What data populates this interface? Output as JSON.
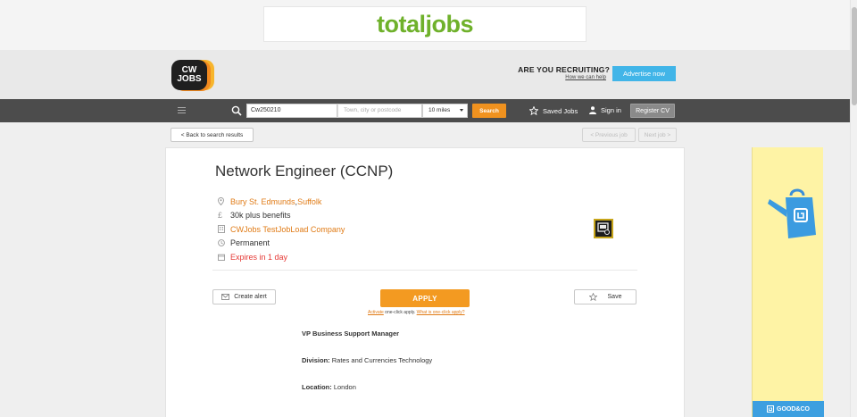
{
  "ad_banner": {
    "brand": "totaljobs"
  },
  "header": {
    "logo_text_line1": "CW",
    "logo_text_line2": "JOBS",
    "recruit_title": "ARE YOU RECRUITING?",
    "recruit_link": "How we can help",
    "advertise_label": "Advertise now"
  },
  "nav": {
    "keyword_value": "Cw250210",
    "location_placeholder": "Town, city or postcode",
    "radius_value": "10 miles",
    "search_label": "Search",
    "saved_jobs_label": "Saved Jobs",
    "sign_in_label": "Sign in",
    "register_label": "Register CV"
  },
  "subnav": {
    "back_label": "< Back to search results",
    "prev_label": "< Previous job",
    "next_label": "Next job >"
  },
  "job": {
    "title": "Network Engineer (CCNP)",
    "location_town": "Bury St. Edmunds",
    "location_sep": ", ",
    "location_county": "Suffolk",
    "salary": "30k plus benefits",
    "company": "CWJobs TestJobLoad Company",
    "job_type": "Permanent",
    "expires": "Expires in 1 day"
  },
  "actions": {
    "create_alert_label": "Create alert",
    "apply_label": "APPLY",
    "apply_sub_activate": "Activate",
    "apply_sub_middle": " one-click apply. ",
    "apply_sub_what": "What is one-click apply?",
    "save_label": "Save"
  },
  "description": {
    "role": "VP Business Support Manager",
    "division_label": "Division:",
    "division_value": " Rates and Currencies Technology",
    "location_label": "Location:",
    "location_value": " London"
  },
  "side_ad": {
    "brand": "GOOD&CO"
  },
  "colors": {
    "accent_orange": "#f39a21",
    "nav_dark": "#4c4c4c",
    "link_orange": "#e07b16",
    "expires_red": "#e53935"
  }
}
